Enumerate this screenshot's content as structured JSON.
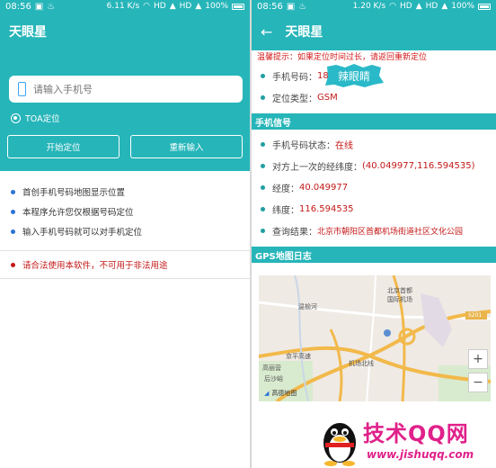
{
  "left": {
    "status": {
      "time": "08:56",
      "signal_text": "6.11 K/s",
      "hd1": "HD",
      "hd2": "HD",
      "battery": "100%"
    },
    "appbar": {
      "title": "天眼星"
    },
    "phone_input": {
      "placeholder": "请输入手机号"
    },
    "mode": {
      "label": "TOA定位"
    },
    "buttons": {
      "locate": "开始定位",
      "reset": "重新输入"
    },
    "features": [
      "首创手机号码地图显示位置",
      "本程序允许您仅根据号码定位",
      "输入手机号码就可以对手机定位"
    ],
    "warning": "请合法使用本软件，不可用于非法用途"
  },
  "right": {
    "status": {
      "time": "08:56",
      "signal_text": "1.20 K/s",
      "hd1": "HD",
      "hd2": "HD",
      "battery": "100%"
    },
    "appbar": {
      "title": "天眼星"
    },
    "tip": "温馨提示：如果定位时间过长，请返回重新定位",
    "phone_number": {
      "label": "手机号码：",
      "value": "18"
    },
    "badge": "辣眼睛",
    "locate_type": {
      "label": "定位类型：",
      "value": "GSM"
    },
    "section_signal": "手机信号",
    "signal_items": [
      {
        "label": "手机号码状态：",
        "value": "在线"
      },
      {
        "label": "对方上一次的经纬度：",
        "value": "(40.049977,116.594535)"
      },
      {
        "label": "经度：",
        "value": "40.049977"
      },
      {
        "label": "纬度：",
        "value": "116.594535"
      },
      {
        "label": "查询结果：",
        "value": "北京市朝阳区首都机场街道社区文化公园"
      }
    ],
    "section_map": "GPS地图日志",
    "map": {
      "labels": {
        "airport": "北京首都\n国际机场",
        "airport1": "北京首都",
        "airport2": "国际机场",
        "road_s201": "S201",
        "road_jingping": "京平高速",
        "road_jichang": "机场北线",
        "place_gaoliying": "高丽营",
        "place_houshayu": "后沙峪",
        "road_xiaoying": "温榆河"
      },
      "zoom_in": "+",
      "zoom_out": "−",
      "provider": "高德地图"
    }
  },
  "watermark": {
    "title": "技术QQ网",
    "url": "www.jishuqq.com"
  },
  "colors": {
    "teal": "#26b5b9",
    "red": "#c41818",
    "pink": "#e0218a"
  }
}
